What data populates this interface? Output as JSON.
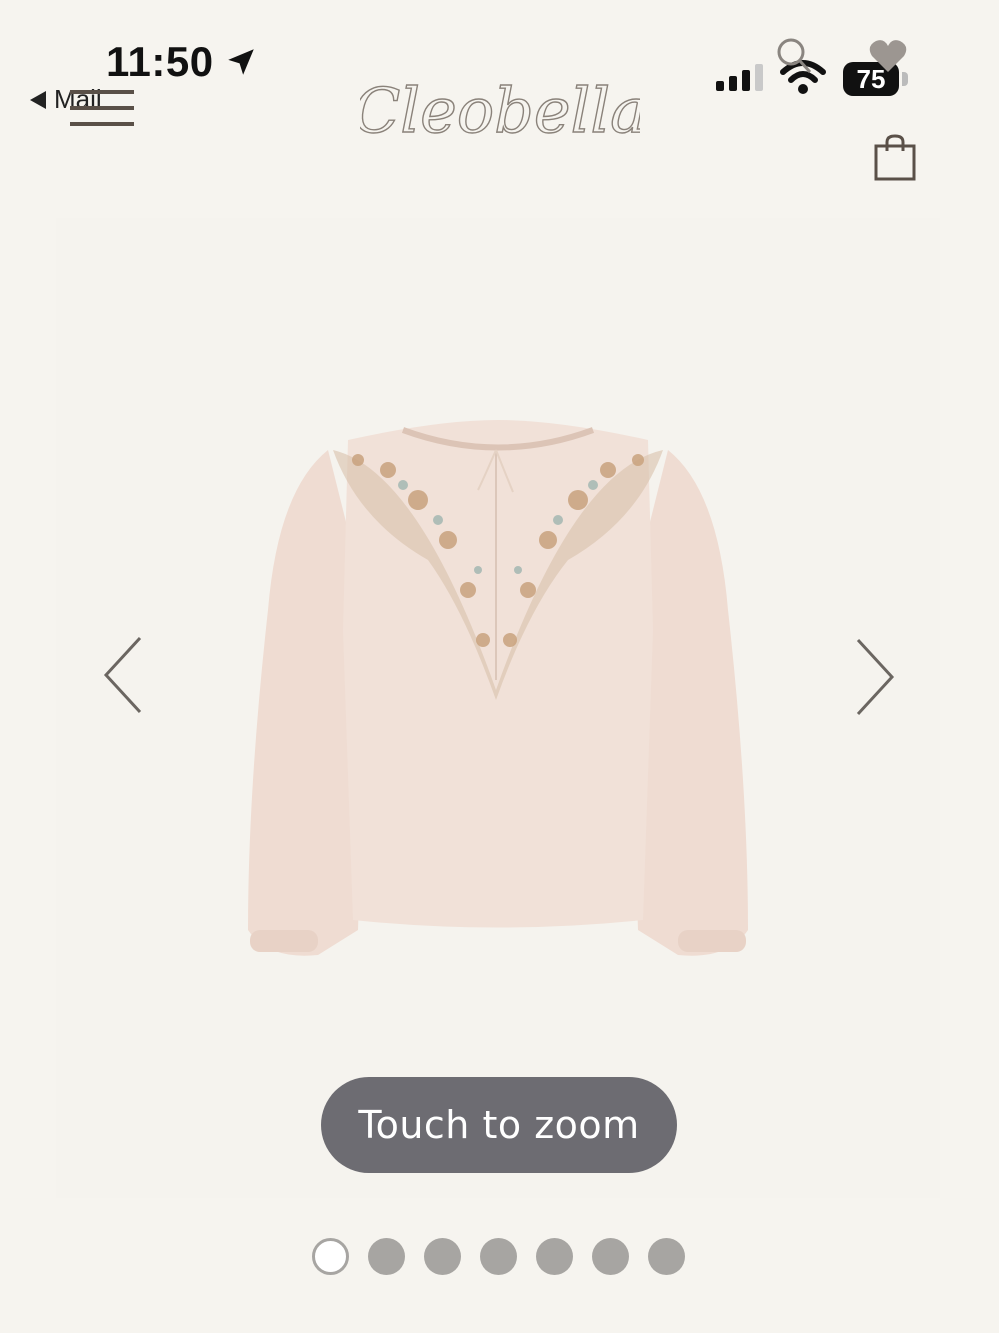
{
  "status_bar": {
    "time": "11:50",
    "back_label": "Mail",
    "battery": "75"
  },
  "header": {
    "brand": "Cleobella",
    "icons": [
      "menu-icon",
      "search-icon",
      "heart-icon",
      "shopping-bag-icon"
    ]
  },
  "gallery": {
    "zoom_hint": "Touch to zoom",
    "image_count": 7,
    "active_index": 0
  },
  "colors": {
    "background": "#f6f4ef",
    "accent_text": "#5a5048",
    "pill": "#6d6c72",
    "dot": "#a7a5a2",
    "garment": "#f0dfd5"
  }
}
